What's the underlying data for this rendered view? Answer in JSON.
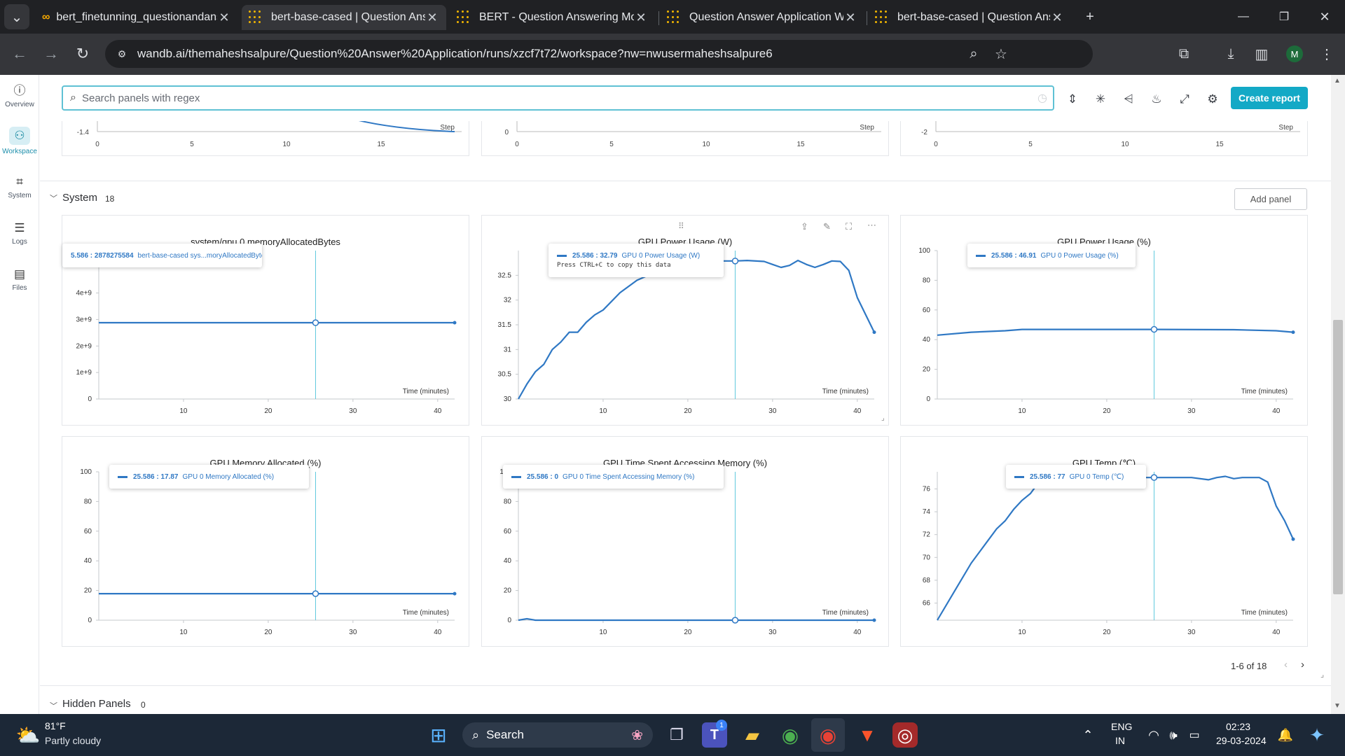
{
  "tabs": [
    {
      "title": "bert_finetunning_questionandanswering",
      "icon": "colab-icon"
    },
    {
      "title": "bert-base-cased | Question Answer Application",
      "icon": "wandb-icon"
    },
    {
      "title": "BERT - Question Answering Model",
      "icon": "wandb-icon"
    },
    {
      "title": "Question Answer Application Workspace",
      "icon": "wandb-icon"
    },
    {
      "title": "bert-base-cased | Question Answer Application",
      "icon": "wandb-icon"
    }
  ],
  "url": "wandb.ai/themaheshsalpure/Question%20Answer%20Application/runs/xzcf7t72/workspace?nw=nwusermaheshsalpure6",
  "profile_initial": "M",
  "nav": [
    {
      "label": "Overview",
      "icon": "info-icon"
    },
    {
      "label": "Workspace",
      "icon": "workspace-icon"
    },
    {
      "label": "System",
      "icon": "chip-icon"
    },
    {
      "label": "Logs",
      "icon": "list-icon"
    },
    {
      "label": "Files",
      "icon": "file-icon"
    }
  ],
  "search": {
    "placeholder": "Search panels with regex"
  },
  "create_report": "Create report",
  "top_charts": [
    {
      "ytick": "-1.4",
      "step": "Step",
      "xticks": [
        "0",
        "5",
        "10",
        "15"
      ]
    },
    {
      "ytick": "0",
      "step": "Step",
      "xticks": [
        "0",
        "5",
        "10",
        "15"
      ]
    },
    {
      "ytick": "-2",
      "step": "Step",
      "xticks": [
        "0",
        "5",
        "10",
        "15"
      ]
    }
  ],
  "section": {
    "title": "System",
    "count": "18",
    "add_panel": "Add panel"
  },
  "chart_data": [
    {
      "type": "line",
      "title": "system/gpu.0.memoryAllocatedBytes",
      "xlabel": "Time (minutes)",
      "xticks": [
        "10",
        "20",
        "30",
        "40"
      ],
      "yticks": [
        "0",
        "1e+9",
        "2e+9",
        "3e+9",
        "4e+9"
      ],
      "ylim": [
        0,
        5600000000
      ],
      "xlim": [
        0,
        42
      ],
      "series": [
        {
          "values": [
            [
              0,
              2878275584
            ],
            [
              42,
              2878275584
            ]
          ]
        }
      ],
      "tooltip": {
        "x": "5.586",
        "value": "2878275584",
        "name": "bert-base-cased sys...moryAllocatedBytes"
      },
      "cursor_x": 25.586
    },
    {
      "type": "line",
      "title": "GPU Power Usage (W)",
      "xlabel": "Time (minutes)",
      "xticks": [
        "10",
        "20",
        "30",
        "40"
      ],
      "yticks": [
        "30",
        "30.5",
        "31",
        "31.5",
        "32",
        "32.5"
      ],
      "ylim": [
        30,
        33
      ],
      "xlim": [
        0,
        42
      ],
      "series": [
        {
          "values": [
            [
              0,
              30
            ],
            [
              1,
              30.3
            ],
            [
              2,
              30.55
            ],
            [
              3,
              30.7
            ],
            [
              4,
              31
            ],
            [
              5,
              31.15
            ],
            [
              6,
              31.35
            ],
            [
              7,
              31.35
            ],
            [
              8,
              31.55
            ],
            [
              9,
              31.7
            ],
            [
              10,
              31.8
            ],
            [
              12,
              32.15
            ],
            [
              14,
              32.4
            ],
            [
              16,
              32.55
            ],
            [
              18,
              32.7
            ],
            [
              20,
              32.79
            ],
            [
              22,
              32.79
            ],
            [
              24,
              32.79
            ],
            [
              25.6,
              32.79
            ],
            [
              27,
              32.8
            ],
            [
              29,
              32.78
            ],
            [
              30,
              32.72
            ],
            [
              31,
              32.66
            ],
            [
              32,
              32.7
            ],
            [
              33,
              32.8
            ],
            [
              34,
              32.72
            ],
            [
              35,
              32.66
            ],
            [
              36,
              32.72
            ],
            [
              37,
              32.79
            ],
            [
              38,
              32.78
            ],
            [
              39,
              32.6
            ],
            [
              40,
              32.05
            ],
            [
              41,
              31.7
            ],
            [
              42,
              31.35
            ]
          ]
        }
      ],
      "tooltip": {
        "x": "25.586",
        "value": "32.79",
        "name": "GPU 0 Power Usage (W)",
        "hint": "Press CTRL+C to copy this data"
      },
      "cursor_x": 25.586
    },
    {
      "type": "line",
      "title": "GPU Power Usage (%)",
      "xlabel": "Time (minutes)",
      "xticks": [
        "10",
        "20",
        "30",
        "40"
      ],
      "yticks": [
        "0",
        "20",
        "40",
        "60",
        "80",
        "100"
      ],
      "ylim": [
        0,
        100
      ],
      "xlim": [
        0,
        42
      ],
      "series": [
        {
          "values": [
            [
              0,
              43
            ],
            [
              4,
              45
            ],
            [
              8,
              46
            ],
            [
              10,
              46.91
            ],
            [
              20,
              46.91
            ],
            [
              25.6,
              46.91
            ],
            [
              35,
              46.7
            ],
            [
              40,
              46
            ],
            [
              42,
              45
            ]
          ]
        }
      ],
      "tooltip": {
        "x": "25.586",
        "value": "46.91",
        "name": "GPU 0 Power Usage (%)"
      },
      "cursor_x": 25.586
    },
    {
      "type": "line",
      "title": "GPU Memory Allocated (%)",
      "xlabel": "Time (minutes)",
      "xticks": [
        "10",
        "20",
        "30",
        "40"
      ],
      "yticks": [
        "0",
        "20",
        "40",
        "60",
        "80",
        "100"
      ],
      "ylim": [
        0,
        100
      ],
      "xlim": [
        0,
        42
      ],
      "series": [
        {
          "values": [
            [
              0,
              17.87
            ],
            [
              42,
              17.87
            ]
          ]
        }
      ],
      "tooltip": {
        "x": "25.586",
        "value": "17.87",
        "name": "GPU 0 Memory Allocated (%)"
      },
      "cursor_x": 25.586
    },
    {
      "type": "line",
      "title": "GPU Time Spent Accessing Memory (%)",
      "xlabel": "Time (minutes)",
      "xticks": [
        "10",
        "20",
        "30",
        "40"
      ],
      "yticks": [
        "0",
        "20",
        "40",
        "60",
        "80",
        "100"
      ],
      "ylim": [
        0,
        100
      ],
      "xlim": [
        0,
        42
      ],
      "series": [
        {
          "values": [
            [
              0,
              0
            ],
            [
              1,
              1
            ],
            [
              2,
              0
            ],
            [
              42,
              0
            ]
          ]
        }
      ],
      "tooltip": {
        "x": "25.586",
        "value": "0",
        "name": "GPU 0 Time Spent Accessing Memory (%)"
      },
      "cursor_x": 25.586
    },
    {
      "type": "line",
      "title": "GPU Temp (℃)",
      "xlabel": "Time (minutes)",
      "xticks": [
        "10",
        "20",
        "30",
        "40"
      ],
      "yticks": [
        "66",
        "68",
        "70",
        "72",
        "74",
        "76"
      ],
      "ylim": [
        64.5,
        77.5
      ],
      "xlim": [
        0,
        42
      ],
      "series": [
        {
          "values": [
            [
              0,
              64.5
            ],
            [
              2,
              67
            ],
            [
              4,
              69.5
            ],
            [
              6,
              71.5
            ],
            [
              7,
              72.5
            ],
            [
              8,
              73.2
            ],
            [
              9,
              74.2
            ],
            [
              10,
              75
            ],
            [
              11,
              75.6
            ],
            [
              12,
              76.6
            ],
            [
              13,
              77
            ],
            [
              20,
              77
            ],
            [
              25.6,
              77
            ],
            [
              30,
              77
            ],
            [
              32,
              76.8
            ],
            [
              33,
              77
            ],
            [
              34,
              77.1
            ],
            [
              35,
              76.9
            ],
            [
              36,
              77
            ],
            [
              38,
              77
            ],
            [
              39,
              76.6
            ],
            [
              40,
              74.5
            ],
            [
              41,
              73.2
            ],
            [
              42,
              71.6
            ]
          ]
        }
      ],
      "tooltip": {
        "x": "25.586",
        "value": "77",
        "name": "GPU 0 Temp (℃)"
      },
      "cursor_x": 25.586
    }
  ],
  "pagination": "1-6 of 18",
  "hidden": {
    "title": "Hidden Panels",
    "count": "0"
  },
  "taskbar": {
    "weather_temp": "81°F",
    "weather_desc": "Partly cloudy",
    "search": "Search",
    "lang1": "ENG",
    "lang2": "IN",
    "time": "02:23",
    "date": "29-03-2024",
    "teams_badge": "1"
  },
  "colors": {
    "accent": "#13a9c6",
    "series": "#2f78c4",
    "cursor": "#5fc9dd"
  }
}
